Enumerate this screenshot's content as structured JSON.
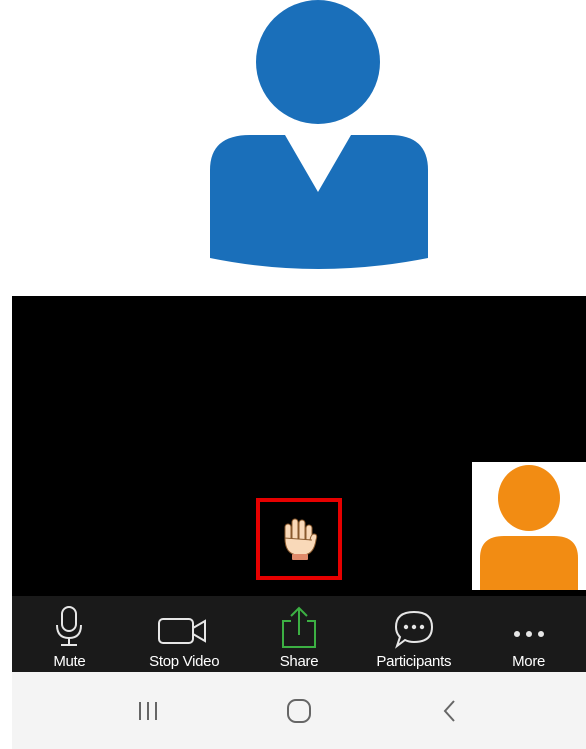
{
  "participant": {
    "avatar_icon": "person-silhouette-icon",
    "avatar_color": "#1a6fba"
  },
  "raise_hand": {
    "icon": "raised-hand-icon",
    "highlight_color": "#e60000"
  },
  "self_view": {
    "avatar_icon": "person-silhouette-icon",
    "avatar_color": "#f28c13"
  },
  "toolbar": {
    "mute_label": "Mute",
    "stop_video_label": "Stop Video",
    "share_label": "Share",
    "participants_label": "Participants",
    "more_label": "More",
    "share_color": "#3cb043"
  },
  "navbar": {
    "recents_icon": "recents-icon",
    "home_icon": "home-icon",
    "back_icon": "back-icon"
  }
}
